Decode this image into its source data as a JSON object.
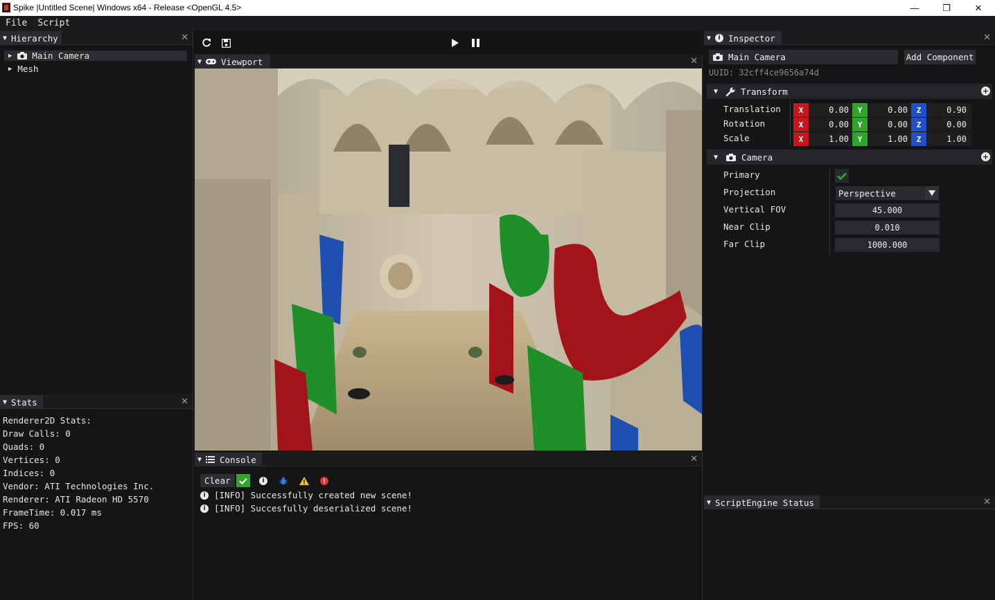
{
  "window": {
    "title": "Spike |Untitled Scene| Windows x64 - Release <OpenGL 4.5>",
    "minimize": "—",
    "maximize": "❐",
    "close": "✕"
  },
  "menu": {
    "items": [
      "File",
      "Script"
    ]
  },
  "hierarchy": {
    "tab": "Hierarchy",
    "items": [
      {
        "label": "Main Camera",
        "icon": "camera-icon",
        "selected": true
      },
      {
        "label": "Mesh"
      }
    ]
  },
  "stats": {
    "tab": "Stats",
    "lines": [
      "Renderer2D Stats:",
      "Draw Calls: 0",
      "Quads: 0",
      "Vertices: 0",
      "Indices: 0",
      "Vendor: ATI Technologies Inc.",
      "Renderer: ATI Radeon HD 5570",
      "FrameTime: 0.017 ms",
      "FPS: 60"
    ]
  },
  "toolbar": {
    "icons": [
      "reload-icon",
      "save-icon",
      "play-icon",
      "pause-icon"
    ]
  },
  "viewport": {
    "tab": "Viewport"
  },
  "console": {
    "tab": "Console",
    "clear_label": "Clear",
    "filter_icons": [
      "check-icon",
      "info-icon",
      "bug-icon",
      "warning-icon",
      "error-icon"
    ],
    "logs": [
      "[INFO] Successfully created new scene!",
      "[INFO] Succesfully deserialized scene!"
    ]
  },
  "inspector": {
    "tab": "Inspector",
    "entity_name": "Main Camera",
    "add_component": "Add Component",
    "uuid": "UUID: 32cff4ce9656a74d",
    "transform": {
      "header": "Transform",
      "rows": [
        {
          "label": "Translation",
          "x": "0.00",
          "y": "0.00",
          "z": "0.90"
        },
        {
          "label": "Rotation",
          "x": "0.00",
          "y": "0.00",
          "z": "0.00"
        },
        {
          "label": "Scale",
          "x": "1.00",
          "y": "1.00",
          "z": "1.00"
        }
      ],
      "axis_labels": [
        "X",
        "Y",
        "Z"
      ]
    },
    "camera": {
      "header": "Camera",
      "primary_label": "Primary",
      "primary_checked": true,
      "projection_label": "Projection",
      "projection_value": "Perspective",
      "fov_label": "Vertical FOV",
      "fov_value": "45.000",
      "near_label": "Near Clip",
      "near_value": "0.010",
      "far_label": "Far Clip",
      "far_value": "1000.000"
    }
  },
  "script_engine": {
    "tab": "ScriptEngine Status"
  },
  "colors": {
    "axis_x": "#c8161d",
    "axis_y": "#2fa52c",
    "axis_z": "#1f4fc9",
    "panel_bg": "#151517",
    "tab_active": "#2b2b2f"
  }
}
